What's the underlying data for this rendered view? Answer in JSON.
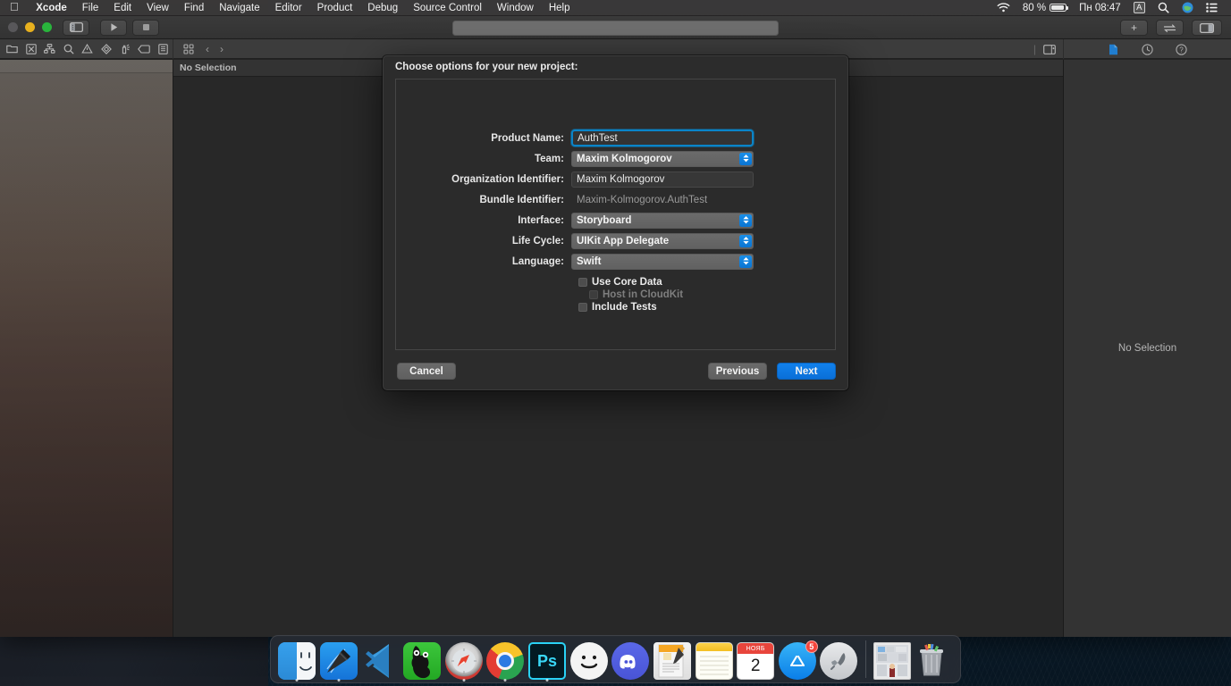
{
  "menubar": {
    "apple_icon": "apple-logo-icon",
    "items": [
      {
        "label": "Xcode",
        "bold": true
      },
      {
        "label": "File"
      },
      {
        "label": "Edit"
      },
      {
        "label": "View"
      },
      {
        "label": "Find"
      },
      {
        "label": "Navigate"
      },
      {
        "label": "Editor"
      },
      {
        "label": "Product"
      },
      {
        "label": "Debug"
      },
      {
        "label": "Source Control"
      },
      {
        "label": "Window"
      },
      {
        "label": "Help"
      }
    ],
    "status": {
      "wifi_icon": "wifi-icon",
      "battery_percent": "80 %",
      "battery_icon": "battery-icon",
      "clock": "Пн 08:47",
      "keyboard_layout": "A",
      "search_icon": "spotlight-search-icon",
      "siri_icon": "siri-globe-icon",
      "control_center_icon": "control-center-icon"
    }
  },
  "xcode": {
    "toolbar": {
      "navigator_toggle_icon": "left-panel-toggle-icon",
      "run_icon": "run-play-icon",
      "stop_icon": "stop-square-icon",
      "search_placeholder": "",
      "search_value": "",
      "add_label": "+",
      "swap_icon": "swap-arrows-icon",
      "inspector_toggle_icon": "right-panel-toggle-icon"
    },
    "navigator_tabs": [
      {
        "name": "project-navigator",
        "icon": "folder-icon"
      },
      {
        "name": "source-control-navigator",
        "icon": "source-control-icon"
      },
      {
        "name": "symbol-navigator",
        "icon": "hierarchy-icon"
      },
      {
        "name": "find-navigator",
        "icon": "magnifier-icon"
      },
      {
        "name": "issue-navigator",
        "icon": "warning-triangle-icon"
      },
      {
        "name": "test-navigator",
        "icon": "diamond-icon"
      },
      {
        "name": "debug-navigator",
        "icon": "debug-spray-icon"
      },
      {
        "name": "breakpoint-navigator",
        "icon": "tag-icon"
      },
      {
        "name": "report-navigator",
        "icon": "report-lines-icon"
      }
    ],
    "jumpbar": {
      "grid_icon": "grid-squares-icon",
      "back_icon": "chevron-left-icon",
      "forward_icon": "chevron-right-icon"
    },
    "editor": {
      "jumpbar_label": "No Selection"
    },
    "inspector": {
      "toggle_icon": "inspector-panel-icon",
      "tabs": [
        {
          "name": "file-inspector-tab",
          "icon": "document-icon",
          "active": true
        },
        {
          "name": "history-inspector-tab",
          "icon": "clock-icon",
          "active": false
        },
        {
          "name": "quick-help-inspector-tab",
          "icon": "question-circle-icon",
          "active": false
        }
      ],
      "empty_label": "No Selection"
    },
    "accent_color": "#0a84c8"
  },
  "sheet": {
    "title": "Choose options for your new project:",
    "fields": [
      {
        "label": "Product Name:",
        "value": "AuthTest",
        "type": "text",
        "focused": true,
        "name": "product-name"
      },
      {
        "label": "Team:",
        "value": "Maxim Kolmogorov",
        "type": "popup",
        "name": "team"
      },
      {
        "label": "Organization Identifier:",
        "value": "Maxim Kolmogorov",
        "type": "text",
        "name": "organization-identifier"
      },
      {
        "label": "Bundle Identifier:",
        "value": "Maxim-Kolmogorov.AuthTest",
        "type": "readonly",
        "name": "bundle-identifier"
      },
      {
        "label": "Interface:",
        "value": "Storyboard",
        "type": "popup",
        "name": "interface"
      },
      {
        "label": "Life Cycle:",
        "value": "UIKit App Delegate",
        "type": "popup",
        "name": "life-cycle"
      },
      {
        "label": "Language:",
        "value": "Swift",
        "type": "popup",
        "name": "language"
      }
    ],
    "checkboxes": [
      {
        "label": "Use Core Data",
        "checked": false,
        "disabled": false,
        "indent": 0,
        "name": "use-core-data"
      },
      {
        "label": "Host in CloudKit",
        "checked": false,
        "disabled": true,
        "indent": 12,
        "name": "host-in-cloudkit"
      },
      {
        "label": "Include Tests",
        "checked": false,
        "disabled": false,
        "indent": 0,
        "name": "include-tests"
      }
    ],
    "buttons": {
      "cancel": "Cancel",
      "previous": "Previous",
      "next": "Next"
    }
  },
  "dock": {
    "items": [
      {
        "name": "finder",
        "icon": "finder-icon",
        "running": true
      },
      {
        "name": "xcode",
        "icon": "xcode-hammer-icon",
        "running": true
      },
      {
        "name": "visual-studio-code",
        "icon": "vscode-icon",
        "running": false
      },
      {
        "name": "sourcetree",
        "icon": "sourcetree-icon",
        "running": false
      },
      {
        "name": "safari",
        "icon": "safari-compass-icon",
        "running": true
      },
      {
        "name": "google-chrome",
        "icon": "chrome-icon",
        "running": true
      },
      {
        "name": "photoshop",
        "icon": "photoshop-ps-icon",
        "label": "Ps",
        "running": true
      },
      {
        "name": "telegram-or-smiley",
        "icon": "smiley-face-icon",
        "running": false
      },
      {
        "name": "discord",
        "icon": "discord-icon",
        "running": false
      },
      {
        "name": "pages",
        "icon": "pages-icon",
        "running": false
      },
      {
        "name": "notes",
        "icon": "notes-icon",
        "running": false
      },
      {
        "name": "calendar",
        "icon": "calendar-icon",
        "month": "НОЯБ",
        "day": "2",
        "running": false
      },
      {
        "name": "app-store",
        "icon": "app-store-icon",
        "badge": "5",
        "running": false
      },
      {
        "name": "launchpad",
        "icon": "launchpad-rocket-icon",
        "running": false
      },
      {
        "name": "photos-stack",
        "icon": "photos-stack-icon",
        "running": false
      },
      {
        "name": "trash",
        "icon": "trash-icon",
        "running": false
      }
    ]
  }
}
